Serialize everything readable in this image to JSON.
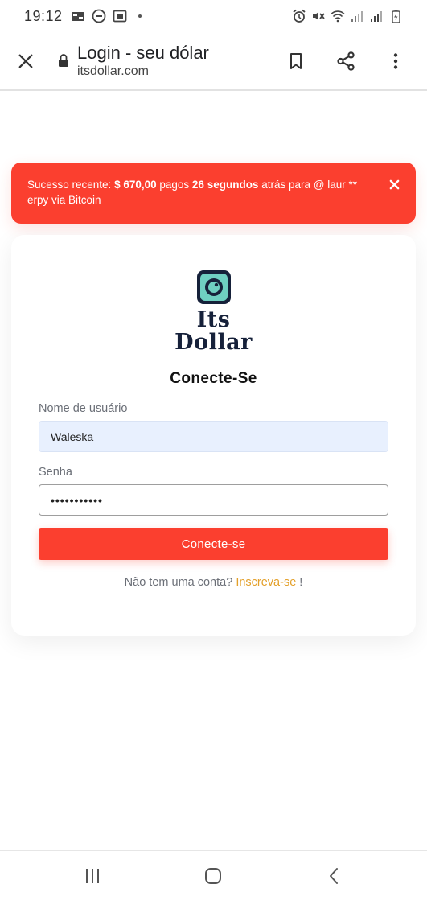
{
  "status_bar": {
    "time": "19:12",
    "left_icons": [
      "payment-icon",
      "do-not-disturb-icon",
      "screen-record-icon"
    ],
    "right_icons": [
      "alarm-icon",
      "mute-icon",
      "wifi-icon",
      "signal-icon",
      "signal-icon-2",
      "battery-charging-icon"
    ]
  },
  "browser": {
    "title": "Login - seu dólar",
    "url": "itsdollar.com"
  },
  "alert": {
    "prefix": "Sucesso recente: ",
    "amount": "$ 670,00",
    "middle": " pagos ",
    "time": "26 segundos",
    "suffix": " atrás para @ laur ** erpy via Bitcoin",
    "close_glyph": "✕"
  },
  "logo": {
    "line1": "Its",
    "line2": "Dollar"
  },
  "login": {
    "title": "Conecte-Se",
    "username_label": "Nome de usuário",
    "username_value": "Waleska",
    "password_label": "Senha",
    "password_value": "•••••••••••",
    "submit_label": "Conecte-se",
    "no_account_text": "Não tem uma conta? ",
    "signup_link": "Inscreva-se",
    "signup_suffix": " !"
  },
  "colors": {
    "accent": "#fb3f2f",
    "link": "#e3a02b",
    "logo_dark": "#16213a",
    "logo_teal": "#6fcfc1"
  }
}
